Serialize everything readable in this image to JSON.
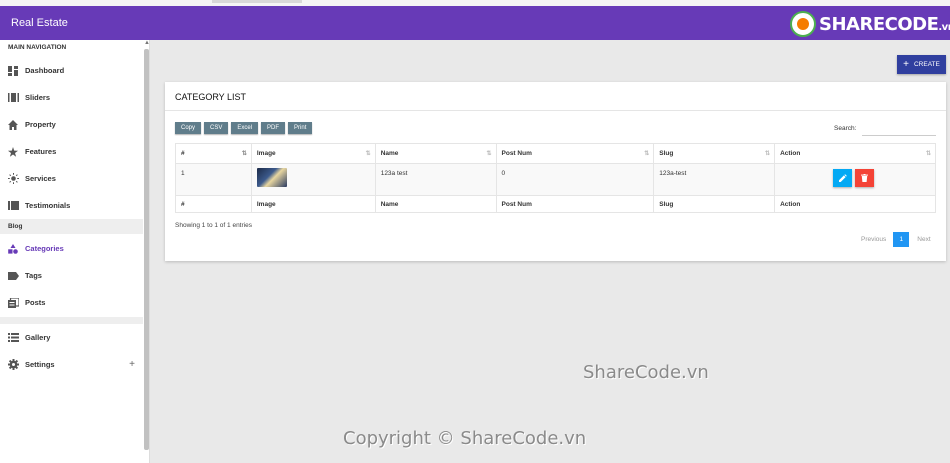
{
  "app": {
    "brand": "Real Estate"
  },
  "logo": {
    "text_main": "SHARECODE",
    "text_suffix": ".vn"
  },
  "sidebar": {
    "main_header": "MAIN NAVIGATION",
    "items": [
      {
        "label": "Dashboard",
        "icon": "dashboard-icon"
      },
      {
        "label": "Sliders",
        "icon": "sliders-icon"
      },
      {
        "label": "Property",
        "icon": "home-icon"
      },
      {
        "label": "Features",
        "icon": "star-icon"
      },
      {
        "label": "Services",
        "icon": "sun-icon"
      },
      {
        "label": "Testimonials",
        "icon": "testimonials-icon"
      }
    ],
    "blog_header": "Blog",
    "blog_items": [
      {
        "label": "Categories",
        "icon": "category-icon",
        "active": true
      },
      {
        "label": "Tags",
        "icon": "tag-icon"
      },
      {
        "label": "Posts",
        "icon": "posts-icon"
      }
    ],
    "bottom_items": [
      {
        "label": "Gallery",
        "icon": "list-icon"
      },
      {
        "label": "Settings",
        "icon": "gear-icon",
        "expand": "+"
      }
    ]
  },
  "toolbar": {
    "create_label": "CREATE",
    "create_icon": "+"
  },
  "card": {
    "title": "CATEGORY LIST",
    "export_buttons": [
      "Copy",
      "CSV",
      "Excel",
      "PDF",
      "Print"
    ],
    "search_label": "Search:",
    "columns": [
      "#",
      "Image",
      "Name",
      "Post Num",
      "Slug",
      "Action"
    ],
    "rows": [
      {
        "num": "1",
        "name": "123a test",
        "post_num": "0",
        "slug": "123a-test"
      }
    ],
    "info": "Showing 1 to 1 of 1 entries",
    "pagination": {
      "previous": "Previous",
      "current": "1",
      "next": "Next"
    }
  },
  "watermarks": {
    "center": "ShareCode.vn",
    "bottom": "Copyright © ShareCode.vn"
  },
  "colors": {
    "primary": "#673ab7",
    "create": "#303f9f",
    "edit": "#03a9f4",
    "delete": "#f44336",
    "export": "#607d8b",
    "page": "#2196f3"
  }
}
